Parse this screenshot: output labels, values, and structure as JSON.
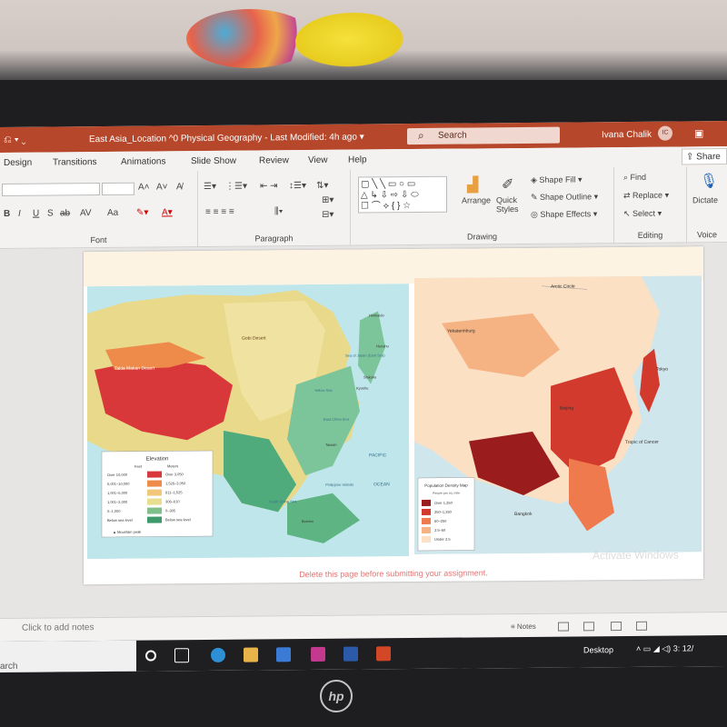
{
  "titlebar": {
    "quick_access": "⎌ ▾ ⌄",
    "document_title": "East Asia_Location ^0 Physical Geography",
    "last_modified": "- Last Modified: 4h ago ▾",
    "search_placeholder": "Search",
    "user_name": "Ivana Chalik",
    "user_initials": "IC",
    "accent_color": "#b7472a"
  },
  "tabs": [
    "Design",
    "Transitions",
    "Animations",
    "Slide Show",
    "Review",
    "View",
    "Help"
  ],
  "share_label": "Share",
  "ribbon": {
    "font_group": {
      "label": "Font",
      "bold": "B",
      "italic": "I",
      "underline": "U",
      "strike": "S",
      "grow": "A˄",
      "shrink": "A˅",
      "case": "Aa",
      "spacing": "AV"
    },
    "paragraph_group": {
      "label": "Paragraph"
    },
    "drawing_group": {
      "label": "Drawing",
      "arrange": "Arrange",
      "quick_styles": "Quick Styles",
      "shape_fill": "Shape Fill",
      "shape_outline": "Shape Outline",
      "shape_effects": "Shape Effects"
    },
    "editing_group": {
      "label": "Editing",
      "find": "Find",
      "replace": "Replace",
      "select": "Select"
    },
    "voice_group": {
      "label": "Voice",
      "dictate": "Dictate"
    }
  },
  "slide": {
    "physical_map": {
      "labels": [
        "Takla Makan Desert",
        "Gobi Desert",
        "Yellow Sea",
        "East China Sea",
        "PACIFIC",
        "OCEAN",
        "South China Sea",
        "Philippine Islands",
        "Hokkaido",
        "Honshu",
        "Kyushu",
        "Shikoku",
        "Taiwan",
        "Borneo",
        "Sea of Japan (East Sea)"
      ],
      "legend_title": "Elevation",
      "legend_cols": [
        "Feet",
        "Meters"
      ],
      "legend_rows": [
        {
          "feet": "Over 10,000",
          "meters": "Over 3,050",
          "color": "#d8383a"
        },
        {
          "feet": "5,001–10,000",
          "meters": "1,526–3,050",
          "color": "#ee8a4a"
        },
        {
          "feet": "1,001–5,000",
          "meters": "611–1,525",
          "color": "#f2c77a"
        },
        {
          "feet": "1,001–2,000",
          "meters": "306–610",
          "color": "#e7de8f"
        },
        {
          "feet": "0–1,000",
          "meters": "0–305",
          "color": "#7fbf8a"
        },
        {
          "feet": "Below sea level",
          "meters": "Below sea level",
          "color": "#3e9a6a"
        }
      ],
      "legend_peak": "▲ Mountain peak"
    },
    "density_map": {
      "labels": [
        "Arctic Circle",
        "Yekaterinburg",
        "Beijing",
        "Tokyo",
        "Tropic of Cancer",
        "Bangkok"
      ],
      "legend_title": "Population Density Map",
      "legend_sub": "People per sq. mile",
      "legend_rows": [
        {
          "label": "Over 1,250",
          "color": "#9b1c1c"
        },
        {
          "label": "250–1,250",
          "color": "#d23a2e"
        },
        {
          "label": "60–250",
          "color": "#ee7a4e"
        },
        {
          "label": "2.5–60",
          "color": "#f5b383"
        },
        {
          "label": "Under 2.5",
          "color": "#fbe0c4"
        }
      ]
    },
    "note": "Delete this page before submitting your assignment.",
    "watermark": "Activate Windows"
  },
  "notes_placeholder": "Click to add notes",
  "statusbar": {
    "notes": "Notes"
  },
  "taskbar": {
    "search_text": "arch",
    "desktop_label": "Desktop",
    "time": "3:",
    "date": "12/"
  },
  "brand": "hp"
}
